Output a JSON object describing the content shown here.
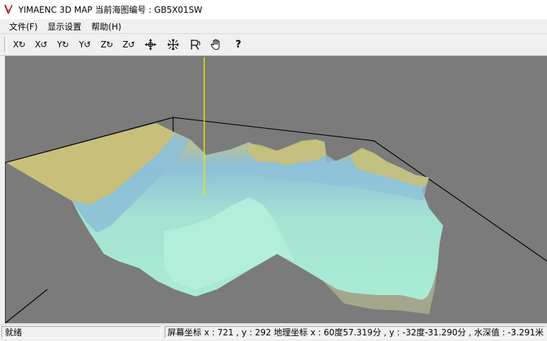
{
  "window": {
    "title": "YIMAENC 3D MAP 当前海图编号 : GB5X01SW",
    "icon": "app-logo-icon"
  },
  "menu": {
    "items": [
      {
        "label": "文件(F)"
      },
      {
        "label": "显示设置"
      },
      {
        "label": "帮助(H)"
      }
    ]
  },
  "toolbar": {
    "buttons": [
      {
        "name": "rotate-x-cw",
        "label": "X↻"
      },
      {
        "name": "rotate-x-ccw",
        "label": "X↺"
      },
      {
        "name": "rotate-y-cw",
        "label": "Y↻"
      },
      {
        "name": "rotate-y-ccw",
        "label": "Y↺"
      },
      {
        "name": "rotate-z-cw",
        "label": "Z↻"
      },
      {
        "name": "rotate-z-ccw",
        "label": "Z↺"
      },
      {
        "name": "move-icon",
        "label": ""
      },
      {
        "name": "zoom-center-icon",
        "label": ""
      },
      {
        "name": "reset-view-icon",
        "label": ""
      },
      {
        "name": "pan-hand-icon",
        "label": ""
      },
      {
        "name": "help-icon",
        "label": "?"
      }
    ]
  },
  "statusbar": {
    "left": "就绪",
    "right": "屏幕坐标 x : 721 , y : 292 地理坐标 x : 60度57.319分 , y : -32度-31.290分 , 水深值 : -3.291米"
  },
  "colors": {
    "viewport_bg": "#7b7b7b",
    "shallow": "#c8c07a",
    "mid": "#8fc2d8",
    "deep": "#a8ead2",
    "axis_line": "#e8e800"
  }
}
